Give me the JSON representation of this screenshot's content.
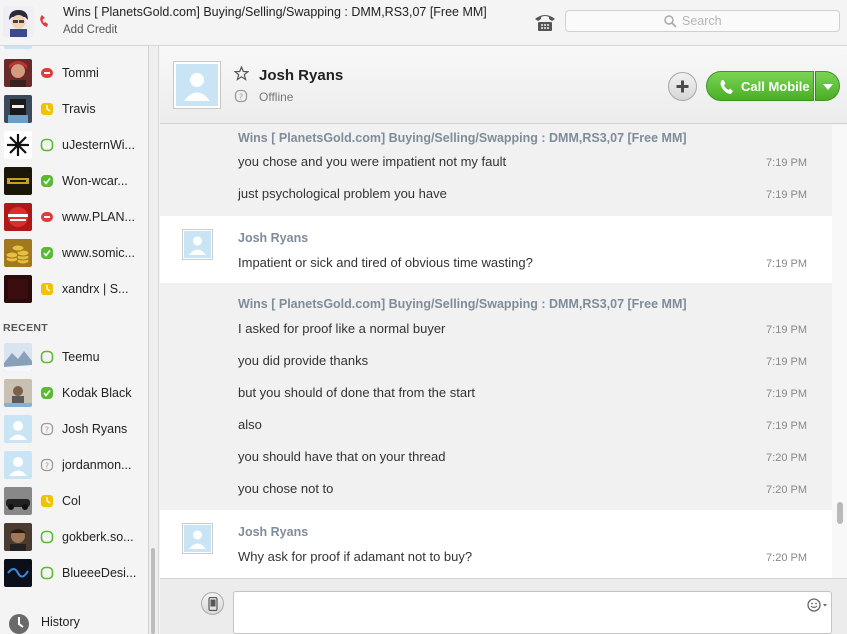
{
  "top": {
    "conversation_title": "Wins [ PlanetsGold.com] Buying/Selling/Swapping : DMM,RS3,07 [Free MM]",
    "add_credit": "Add Credit",
    "search_placeholder": "Search"
  },
  "sidebar": {
    "contacts": [
      {
        "name": "Tommi",
        "status": "busy"
      },
      {
        "name": "Travis",
        "status": "away"
      },
      {
        "name": "uJesternWi...",
        "status": "online-ring"
      },
      {
        "name": "Won-wcar...",
        "status": "online"
      },
      {
        "name": "www.PLAN...",
        "status": "busy"
      },
      {
        "name": "www.somic...",
        "status": "online"
      },
      {
        "name": "xandrx | S...",
        "status": "away"
      }
    ],
    "recent_label": "RECENT",
    "recent": [
      {
        "name": "Teemu",
        "status": "online-ring"
      },
      {
        "name": "Kodak Black",
        "status": "online"
      },
      {
        "name": "Josh Ryans",
        "status": "offline"
      },
      {
        "name": "jordanmon...",
        "status": "offline"
      },
      {
        "name": "Col",
        "status": "away"
      },
      {
        "name": "gokberk.so...",
        "status": "online-ring"
      },
      {
        "name": "BlueeeDesi...",
        "status": "online-ring"
      }
    ],
    "history_label": "History"
  },
  "conversation": {
    "contact_name": "Josh Ryans",
    "contact_status": "Offline",
    "call_label": "Call Mobile"
  },
  "messages": [
    {
      "sender": "Wins [ PlanetsGold.com] Buying/Selling/Swapping : DMM,RS3,07 [Free MM]",
      "lines": [
        {
          "text": "you chose and you were impatient not my fault",
          "time": "7:19 PM"
        },
        {
          "text": "just psychological problem you have",
          "time": "7:19 PM"
        }
      ]
    },
    {
      "sender": "Josh Ryans",
      "lines": [
        {
          "text": "Impatient or sick and tired of obvious time wasting?",
          "time": "7:19 PM"
        }
      ]
    },
    {
      "sender": "Wins [ PlanetsGold.com] Buying/Selling/Swapping : DMM,RS3,07 [Free MM]",
      "lines": [
        {
          "text": "I asked for proof like a normal buyer",
          "time": "7:19 PM"
        },
        {
          "text": "you did provide thanks",
          "time": "7:19 PM"
        },
        {
          "text": "but you should of done that from the start",
          "time": "7:19 PM"
        },
        {
          "text": "also",
          "time": "7:19 PM"
        },
        {
          "text": "you should have that on your thread",
          "time": "7:20 PM"
        },
        {
          "text": "you chose not to",
          "time": "7:20 PM"
        }
      ]
    },
    {
      "sender": "Josh Ryans",
      "lines": [
        {
          "text": "Why ask for proof if adamant not to buy?",
          "time": "7:20 PM"
        }
      ]
    }
  ],
  "colors": {
    "online": "#5bb933",
    "away": "#f2c200",
    "busy": "#e23b3b",
    "offline": "#9a9a9a",
    "call_green": "#4aae26",
    "sender_grey": "#7f8c9a"
  }
}
